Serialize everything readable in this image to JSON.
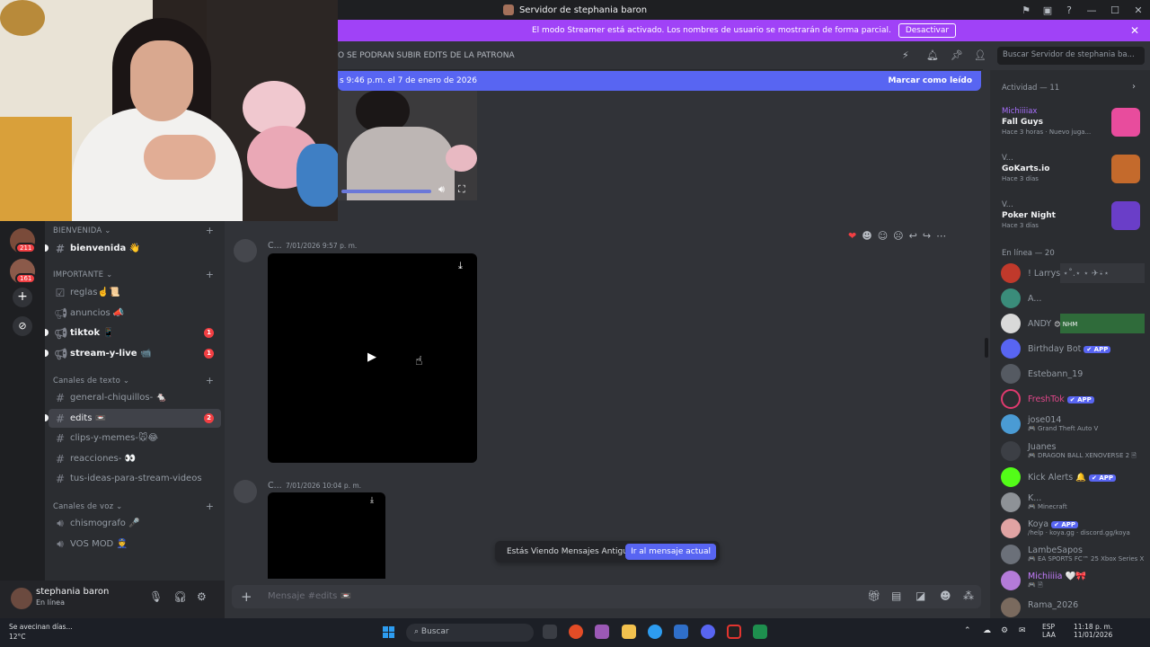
{
  "window": {
    "title": "Servidor de stephania baron"
  },
  "streamer_banner": {
    "text": "El modo Streamer está activado. Los nombres de usuario se mostrarán de forma parcial.",
    "button": "Desactivar"
  },
  "channel_header": {
    "topic": "O SE PODRAN SUBIR EDITS DE LA PATRONA",
    "search_placeholder": "Buscar Servidor de stephania ba..."
  },
  "new_messages_bar": {
    "text": "s 9:46 p.m. el 7 de enero de 2026",
    "action": "Marcar como leído"
  },
  "servers": {
    "badges": [
      "211",
      "161"
    ]
  },
  "channels": {
    "categories": [
      {
        "name": "BIENVENIDA",
        "channels": [
          {
            "name": "bienvenida 👋",
            "bold": true
          }
        ]
      },
      {
        "name": "IMPORTANTE",
        "channels": [
          {
            "name": "reglas☝️📜"
          },
          {
            "name": "anuncios 📣"
          },
          {
            "name": "tiktok 📱",
            "bold": true,
            "badge": "1"
          },
          {
            "name": "stream-y-live 📹",
            "bold": true,
            "badge": "1"
          }
        ]
      },
      {
        "name": "Canales de texto",
        "channels": [
          {
            "name": "general-chiquillos- 🐁"
          },
          {
            "name": "edits 📼",
            "active": true,
            "badge": "2"
          },
          {
            "name": "clips-y-memes-🐭😂"
          },
          {
            "name": "reacciones- 👀"
          },
          {
            "name": "tus-ideas-para-stream-videos"
          }
        ]
      },
      {
        "name": "Canales de voz",
        "channels": [
          {
            "name": "chismografo 🎤"
          },
          {
            "name": "VOS MOD 👮"
          }
        ]
      }
    ]
  },
  "user_panel": {
    "name": "stephania baron",
    "status": "En línea"
  },
  "messages": [
    {
      "author": "C...",
      "time": "7/01/2026 9:57 p. m."
    },
    {
      "author": "C...",
      "time": "7/01/2026 10:04 p. m."
    }
  ],
  "old_messages_pill": {
    "text": "Estás Viendo Mensajes Antiguos",
    "button": "Ir al mensaje actual"
  },
  "composer": {
    "placeholder": "Mensaje #edits 📼"
  },
  "activity": {
    "header": "Actividad — 11",
    "items": [
      {
        "user": "Michiiiiax",
        "game": "Fall Guys",
        "time": "Hace 3 horas · Nuevo juga..."
      },
      {
        "user": "V...",
        "game": "GoKarts.io",
        "time": "Hace 3 días"
      },
      {
        "user": "V...",
        "game": "Poker Night",
        "time": "Hace 3 días"
      }
    ]
  },
  "members": {
    "online_header": "En línea — 20",
    "list": [
      {
        "name": "! Larrys ⋆˚.⋆ ⋆ ✈︎⍣⋆",
        "sub": ""
      },
      {
        "name": "A...",
        "sub": ""
      },
      {
        "name": "ANDY",
        "tag": "😊 NHM",
        "sub": ""
      },
      {
        "name": "Birthday Bot",
        "app": "✔ APP",
        "sub": ""
      },
      {
        "name": "Estebann_19",
        "sub": ""
      },
      {
        "name": "FreshTok",
        "app": "✔ APP",
        "sub": ""
      },
      {
        "name": "jose014",
        "sub": "🎮 Grand Theft Auto V"
      },
      {
        "name": "Juanes",
        "sub": "🎮 DRAGON BALL XENOVERSE 2 🗎"
      },
      {
        "name": "Kick Alerts 🔔",
        "app": "✔ APP",
        "sub": ""
      },
      {
        "name": "K...",
        "sub": "🎮 Minecraft"
      },
      {
        "name": "Koya",
        "app": "✔ APP",
        "sub": "/help · koya.gg · discord.gg/koya"
      },
      {
        "name": "LambeSapos",
        "sub": "🎮 EA SPORTS FC™ 25 Xbox Series X"
      },
      {
        "name": "Michiiiia 🤍🎀",
        "sub": "🎮 🗎"
      },
      {
        "name": "Rama_2026",
        "sub": ""
      }
    ]
  },
  "taskbar": {
    "weather_text": "Se avecinan días...",
    "temperature": "12°C",
    "search": "Buscar",
    "lang_top": "ESP",
    "lang_bottom": "LAA",
    "time": "11:18 p. m.",
    "date": "11/01/2026"
  },
  "colors": {
    "streamer_banner": "#a042f7",
    "new_messages": "#5865f2",
    "badge": "#f23f43"
  }
}
